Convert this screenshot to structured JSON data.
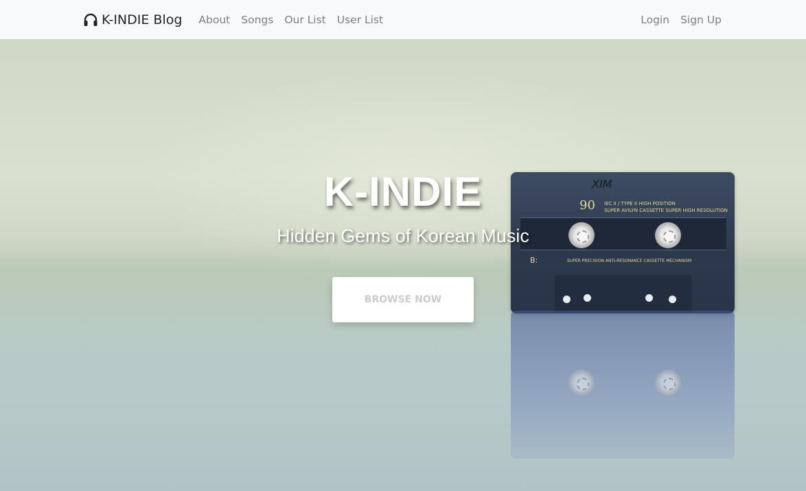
{
  "navbar": {
    "brand": "K-INDIE Blog",
    "brand_icon": "headphones-icon",
    "links": [
      "About",
      "Songs",
      "Our List",
      "User List"
    ],
    "auth_links": [
      "Login",
      "Sign Up"
    ]
  },
  "hero": {
    "title": "K-INDIE",
    "subtitle": "Hidden Gems of Korean Music",
    "button_label": "BROWSE NOW"
  },
  "cassette": {
    "handwriting": "XIM",
    "length": "90",
    "label_line1": "IEC II / TYPE II  HIGH POSITION",
    "label_line2": "SUPER AVILYN CASSETTE  SUPER HIGH RESOLUTION",
    "side": "B:",
    "mechanism": "SUPER PRECISION ANTI-RESONANCE CASSETTE MECHANISM"
  },
  "colors": {
    "navbar_bg": "#f8f9fa",
    "nav_link": "#7b7f83",
    "brand_text": "#212529",
    "button_text": "#c9cdc9"
  }
}
